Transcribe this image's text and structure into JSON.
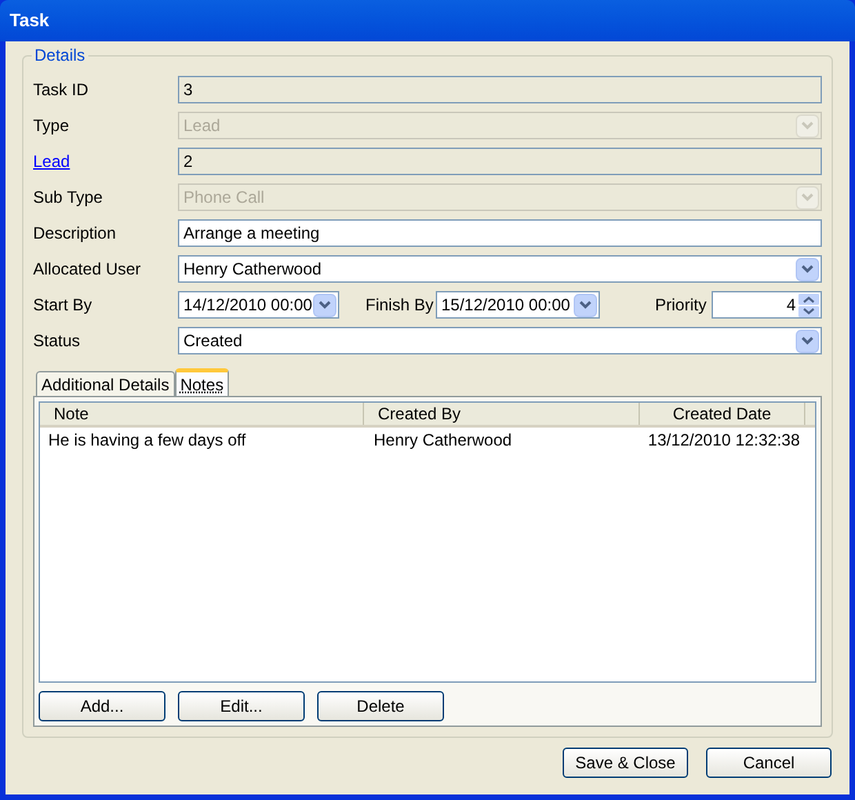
{
  "window": {
    "title": "Task"
  },
  "details": {
    "legend": "Details",
    "fields": [
      {
        "label": "Task ID",
        "link": false,
        "kind": "text",
        "value": "3",
        "disabled": true
      },
      {
        "label": "Type",
        "link": false,
        "kind": "combo",
        "value": "Lead",
        "disabled": true
      },
      {
        "label": "Lead",
        "link": true,
        "kind": "text",
        "value": "2",
        "disabled": true
      },
      {
        "label": "Sub Type",
        "link": false,
        "kind": "combo",
        "value": "Phone Call",
        "disabled": true
      },
      {
        "label": "Description",
        "link": false,
        "kind": "text",
        "value": "Arrange a meeting",
        "disabled": false
      },
      {
        "label": "Allocated User",
        "link": false,
        "kind": "combo",
        "value": "Henry Catherwood",
        "disabled": false
      }
    ],
    "schedule": {
      "start_label": "Start By",
      "start_value": "14/12/2010 00:00",
      "finish_label": "Finish By",
      "finish_value": "15/12/2010 00:00",
      "priority_label": "Priority",
      "priority_value": "4"
    },
    "status": {
      "label": "Status",
      "value": "Created"
    }
  },
  "tabs": [
    {
      "label": "Additional Details",
      "selected": false
    },
    {
      "label": "Notes",
      "selected": true
    }
  ],
  "notes": {
    "columns": [
      "Note",
      "Created By",
      "Created Date"
    ],
    "rows": [
      [
        "He is having a few days off",
        "Henry Catherwood",
        "13/12/2010 12:32:38"
      ]
    ],
    "buttons": [
      "Add...",
      "Edit...",
      "Delete"
    ]
  },
  "buttons": [
    "Save & Close",
    "Cancel"
  ]
}
